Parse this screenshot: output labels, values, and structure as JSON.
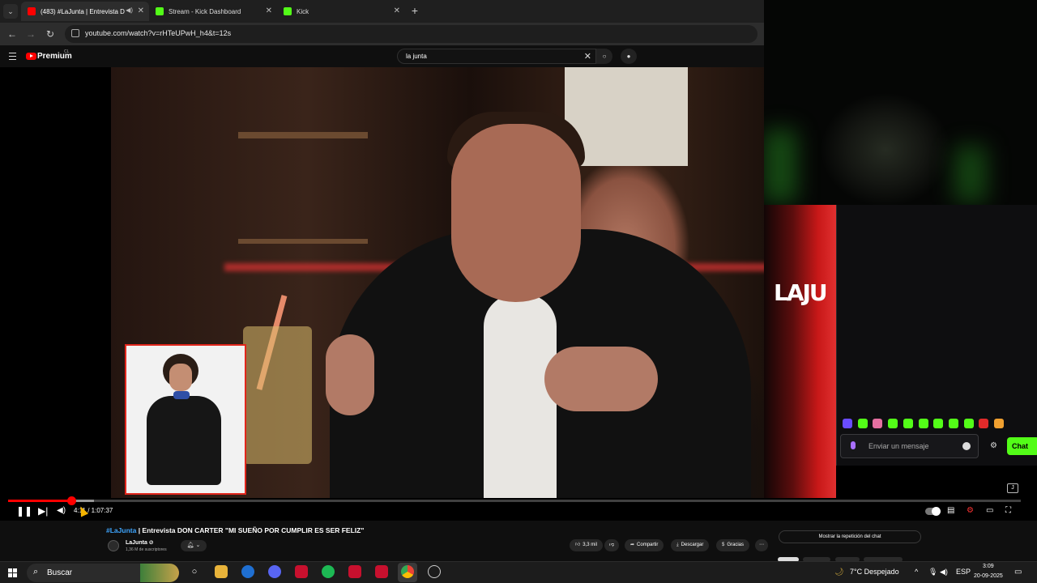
{
  "browser": {
    "tabs": [
      {
        "label": "(483) #LaJunta | Entrevista D",
        "color": "#ff0000"
      },
      {
        "label": "Stream - Kick Dashboard",
        "color": "#53fc18"
      },
      {
        "label": "Kick",
        "color": "#53fc18"
      }
    ],
    "url": "youtube.com/watch?v=rHTeUPwH_h4&t=12s"
  },
  "youtube": {
    "brand": "Premium",
    "region": "CL",
    "search_query": "la junta",
    "player": {
      "current_time": "4:11",
      "duration": "1:07:37",
      "progress": 0.062,
      "buffered": 0.085
    },
    "video": {
      "hashtag": "#LaJunta",
      "title": " | Entrevista DON CARTER \"MI SUEÑO POR CUMPLIR ES SER FELIZ\"",
      "channel": "LaJunta ⊘",
      "subscribers": "1,36 M de suscriptores"
    },
    "actions": {
      "likes": "3,3 mil",
      "share": "Compartir",
      "download": "Descargar",
      "thanks": "Gracias",
      "chat_replay": "Mostrar la repetición del chat"
    }
  },
  "video_scene": {
    "backdrop_text": "LAJU"
  },
  "kick_chat": {
    "placeholder": "Enviar un mensaje",
    "send_label": "Chat",
    "emote_colors": [
      "#6a4cff",
      "#53fc18",
      "#e46fa0",
      "#53fc18",
      "#53fc18",
      "#53fc18",
      "#53fc18",
      "#53fc18",
      "#53fc18",
      "#e02a2a",
      "#f0a030"
    ]
  },
  "taskbar": {
    "search_label": "Buscar",
    "weather": "7°C Despejado",
    "language": "ESP",
    "time": "3:09",
    "date": "20-09-2025"
  }
}
